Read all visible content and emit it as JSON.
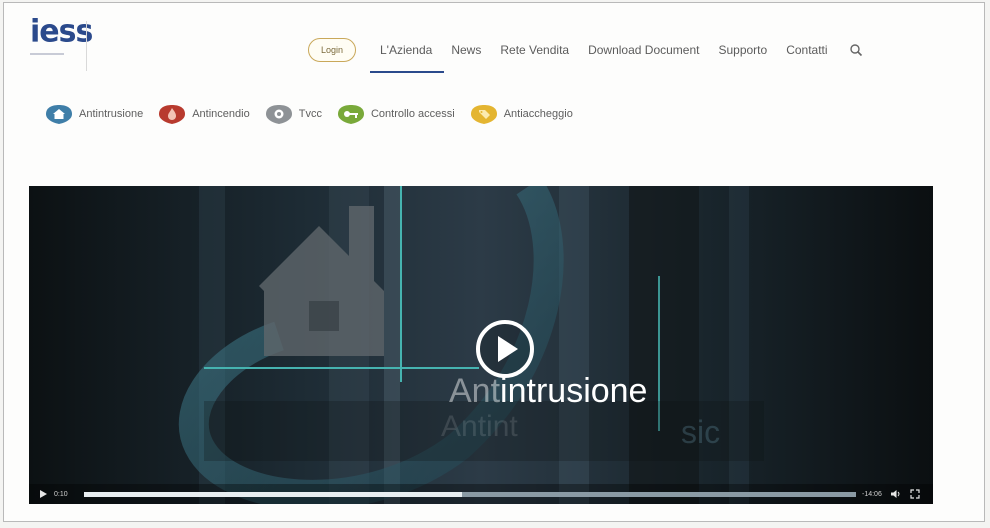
{
  "header": {
    "logo_text": "iess",
    "login_label": "Login",
    "nav": [
      "L'Azienda",
      "News",
      "Rete Vendita",
      "Download Document",
      "Supporto",
      "Contatti"
    ],
    "active_nav_index": 0
  },
  "categories": [
    {
      "label": "Antintrusione",
      "icon": "house-icon",
      "color": "#3f7ea8"
    },
    {
      "label": "Antincendio",
      "icon": "flame-icon",
      "color": "#b83a2e"
    },
    {
      "label": "Tvcc",
      "icon": "eye-icon",
      "color": "#8e9296"
    },
    {
      "label": "Controllo accessi",
      "icon": "key-icon",
      "color": "#79a93a"
    },
    {
      "label": "Antiaccheggio",
      "icon": "tag-icon",
      "color": "#e4b531"
    }
  ],
  "video": {
    "title_prefix": "Ant",
    "title_main": "intrusione",
    "ghost_text_1": "Antint",
    "ghost_text_2": "sic",
    "elapsed": "0:10",
    "remaining": "-14:06",
    "progress": 0.49
  },
  "colors": {
    "brand": "#2b4a8c",
    "login_border": "#c9a85a",
    "video_bg": "#0f1416",
    "accent_teal": "#46b3b0"
  }
}
